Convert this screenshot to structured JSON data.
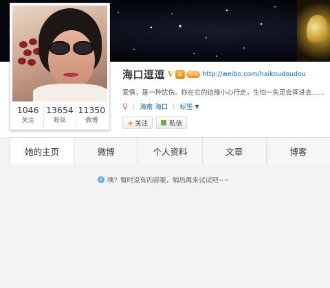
{
  "profile": {
    "name": "海口逗逗",
    "verified_mark": "V",
    "vip_badge": "会",
    "club_badge": "Club",
    "weibo_url": "http://weibo.com/haikoudoudou",
    "bio": "爱情，是一种忧伤。你在它的边缘小心行走，生怕一失足会摔进去……",
    "location": "海南 海口",
    "tags_label": "标签",
    "follow_button": "关注",
    "message_button": "私信"
  },
  "stats": [
    {
      "value": "1046",
      "label": "关注"
    },
    {
      "value": "13654",
      "label": "粉丝"
    },
    {
      "value": "11350",
      "label": "微博"
    }
  ],
  "tabs": [
    {
      "label": "她的主页",
      "active": true
    },
    {
      "label": "微博"
    },
    {
      "label": "个人资料"
    },
    {
      "label": "文章"
    },
    {
      "label": "博客"
    }
  ],
  "feed": {
    "empty_message": "咦？暂时没有内容哦，稍后再来试试吧~~"
  },
  "colors": {
    "link": "#0a67ae",
    "follow_plus": "#f07a1a",
    "message_icon": "#62b547"
  }
}
